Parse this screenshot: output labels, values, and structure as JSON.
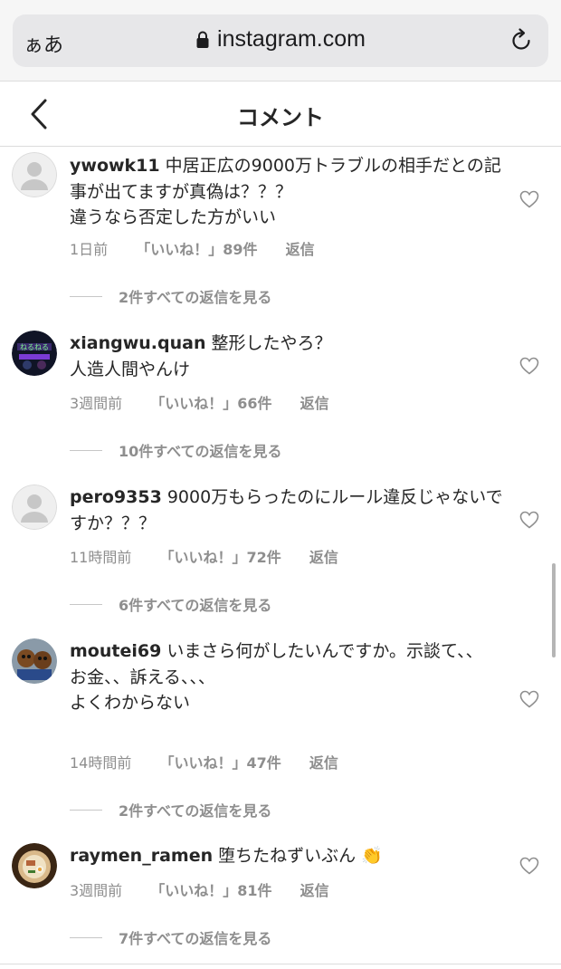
{
  "browser": {
    "aa": "ぁあ",
    "url": "instagram.com"
  },
  "header": {
    "title": "コメント"
  },
  "comments": [
    {
      "user": "ywowk11",
      "text": "中居正広の9000万トラブルの相手だとの記事が出てますが真偽は？？？",
      "text2": "違うなら否定した方がいい",
      "time": "1日前",
      "likes": "「いいね！」89件",
      "reply": "返信",
      "replies": "2件すべての返信を見る"
    },
    {
      "user": "xiangwu.quan",
      "text": "整形したやろ？",
      "text2": "人造人間やんけ",
      "time": "3週間前",
      "likes": "「いいね！」66件",
      "reply": "返信",
      "replies": "10件すべての返信を見る"
    },
    {
      "user": "pero9353",
      "text": "9000万もらったのにルール違反じゃないですか？？？",
      "text2": "",
      "time": "11時間前",
      "likes": "「いいね！」72件",
      "reply": "返信",
      "replies": "6件すべての返信を見る"
    },
    {
      "user": "moutei69",
      "text": "いまさら何がしたいんですか。示談て、、",
      "text2": "お金、、訴える、、、",
      "text3": "よくわからない",
      "time": "14時間前",
      "likes": "「いいね！」47件",
      "reply": "返信",
      "replies": "2件すべての返信を見る"
    },
    {
      "user": "raymen_ramen",
      "text": "堕ちたねずいぶん",
      "emoji": "👏",
      "time": "3週間前",
      "likes": "「いいね！」81件",
      "reply": "返信",
      "replies": "7件すべての返信を見る"
    }
  ],
  "colors": {
    "text": "#262626",
    "secondary": "#8e8e8e",
    "divider": "#dbdbdb"
  }
}
